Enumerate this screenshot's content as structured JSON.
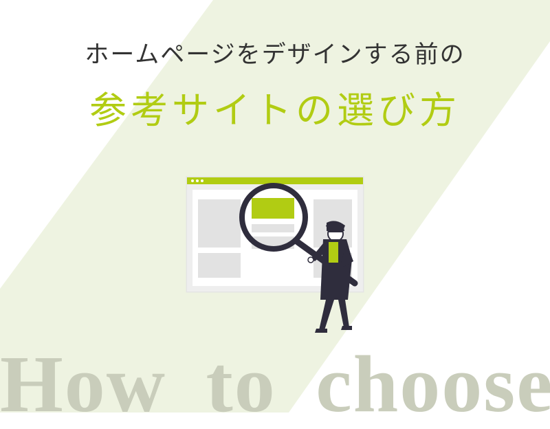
{
  "header": {
    "subtitle": "ホームページをデザインする前の",
    "title": "参考サイトの選び方"
  },
  "illustration": {
    "icon": "search-website-illustration"
  },
  "footer": {
    "english_text": "How to choose"
  },
  "colors": {
    "accent": "#b1cc13",
    "band": "#eef3e1",
    "text_dark": "#333333",
    "english_text": "#c9cdbb",
    "figure_dark": "#2f2d3d"
  }
}
